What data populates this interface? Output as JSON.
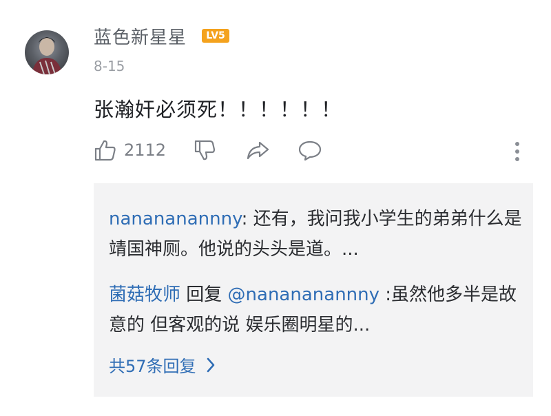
{
  "comment": {
    "username": "蓝色新星星",
    "level_badge": "LV5",
    "date": "8-15",
    "text": "张瀚奸必须死！！！！！！",
    "like_count": "2112"
  },
  "replies": [
    {
      "author": "nanananannny",
      "colon": ": ",
      "text": "还有，我问我小学生的弟弟什么是靖国神厕。他说的头头是道。..."
    },
    {
      "author": "菌菇牧师",
      "reply_word": " 回复 ",
      "target": "@nanananannny",
      "text": " :虽然他多半是故意的 但客观的说 娱乐圈明星的..."
    }
  ],
  "view_more_label": "共57条回复",
  "icons": [
    "avatar",
    "thumbs-up-icon",
    "thumbs-down-icon",
    "share-icon",
    "reply-bubble-icon",
    "more-dots-icon",
    "chevron-right-icon"
  ],
  "colors": {
    "link_blue": "#2f6db5",
    "badge_orange": "#f4a21d",
    "reply_bg": "#f3f3f4"
  }
}
